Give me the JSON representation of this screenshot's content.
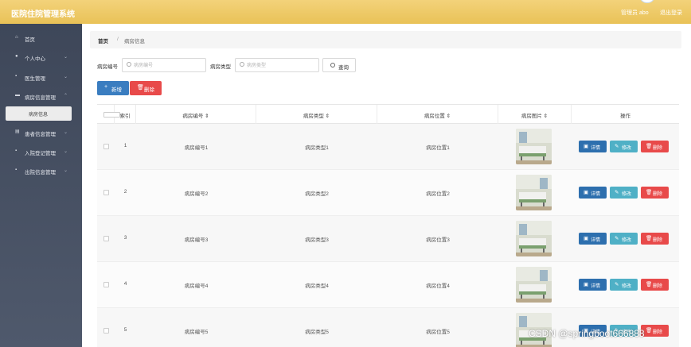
{
  "header": {
    "app_title": "医院住院管理系统",
    "admin_label": "管理员 abo",
    "logout_label": "退出登录"
  },
  "sidebar": {
    "items": [
      {
        "label": "首页",
        "icon": "home-icon",
        "has_children": false
      },
      {
        "label": "个人中心",
        "icon": "user-icon",
        "has_children": true
      },
      {
        "label": "医生管理",
        "icon": "grid-icon",
        "has_children": true
      },
      {
        "label": "病房信息管理",
        "icon": "bed-icon",
        "has_children": true
      },
      {
        "label": "患者信息管理",
        "icon": "document-icon",
        "has_children": true
      },
      {
        "label": "入院登记管理",
        "icon": "grid-icon",
        "has_children": true
      },
      {
        "label": "出院信息管理",
        "icon": "grid-icon",
        "has_children": true
      }
    ],
    "active_sub": "病房信息"
  },
  "breadcrumb": {
    "home": "首页",
    "separator": "/",
    "current": "病房信息"
  },
  "filters": {
    "room_no_label": "病房编号",
    "room_no_placeholder": "病房编号",
    "room_type_label": "病房类型",
    "room_type_placeholder": "病房类型",
    "query_label": "查询"
  },
  "actions": {
    "add_label": "新增",
    "delete_label": "删除"
  },
  "table": {
    "columns": [
      "索引",
      "病房编号",
      "病房类型",
      "病房位置",
      "病房图片",
      "操作"
    ],
    "row_actions": {
      "detail": "详情",
      "edit": "修改",
      "delete": "删除"
    },
    "rows": [
      {
        "index": "1",
        "room_no": "病房编号1",
        "room_type": "病房类型1",
        "room_location": "病房位置1"
      },
      {
        "index": "2",
        "room_no": "病房编号2",
        "room_type": "病房类型2",
        "room_location": "病房位置2"
      },
      {
        "index": "3",
        "room_no": "病房编号3",
        "room_type": "病房类型3",
        "room_location": "病房位置3"
      },
      {
        "index": "4",
        "room_no": "病房编号4",
        "room_type": "病房类型4",
        "room_location": "病房位置4"
      },
      {
        "index": "5",
        "room_no": "病房编号5",
        "room_type": "病房类型5",
        "room_location": "病房位置5"
      }
    ]
  },
  "watermark": "CSDN @springboot666888",
  "colors": {
    "topbar": "#e9c257",
    "sidebar": "#434c5e",
    "primary": "#3a7dc0",
    "danger": "#e84a4a",
    "info": "#4fb0c6"
  }
}
